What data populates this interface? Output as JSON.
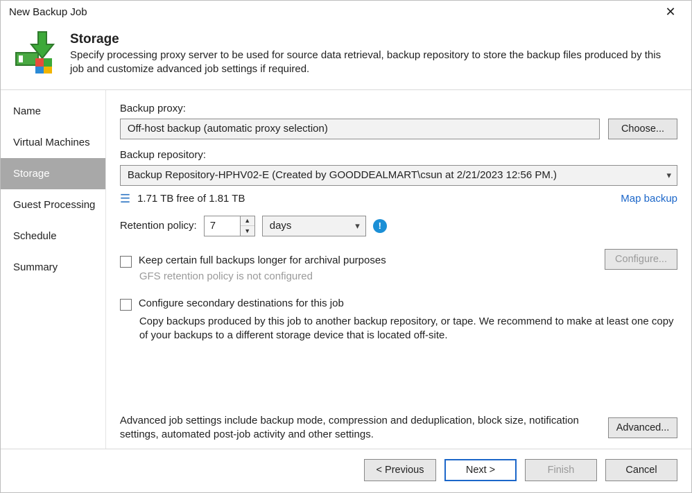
{
  "window": {
    "title": "New Backup Job",
    "close": "✕"
  },
  "header": {
    "heading": "Storage",
    "subheading": "Specify processing proxy server to be used for source data retrieval, backup repository to store the backup files produced by this job and customize advanced job settings if required."
  },
  "sidebar": {
    "items": [
      {
        "label": "Name",
        "active": false
      },
      {
        "label": "Virtual Machines",
        "active": false
      },
      {
        "label": "Storage",
        "active": true
      },
      {
        "label": "Guest Processing",
        "active": false
      },
      {
        "label": "Schedule",
        "active": false
      },
      {
        "label": "Summary",
        "active": false
      }
    ]
  },
  "content": {
    "proxy_label": "Backup proxy:",
    "proxy_value": "Off-host backup (automatic proxy selection)",
    "choose_btn": "Choose...",
    "repo_label": "Backup repository:",
    "repo_value": "Backup Repository-HPHV02-E (Created by GOODDEALMART\\csun at 2/21/2023 12:56 PM.)",
    "free_text": "1.71 TB free of 1.81 TB",
    "map_link": "Map backup",
    "retention_label": "Retention policy:",
    "retention_value": "7",
    "retention_unit": "days",
    "cb_gfs": "Keep certain full backups longer for archival purposes",
    "gfs_hint": "GFS retention policy is not configured",
    "configure_btn": "Configure...",
    "cb_secondary": "Configure secondary destinations for this job",
    "secondary_desc": "Copy backups produced by this job to another backup repository, or tape. We recommend to make at least one copy of your backups to a different storage device that is located off-site.",
    "advanced_text": "Advanced job settings include backup mode, compression and deduplication, block size, notification settings, automated post-job activity and other settings.",
    "advanced_btn": "Advanced..."
  },
  "footer": {
    "previous": "< Previous",
    "next": "Next >",
    "finish": "Finish",
    "cancel": "Cancel"
  }
}
